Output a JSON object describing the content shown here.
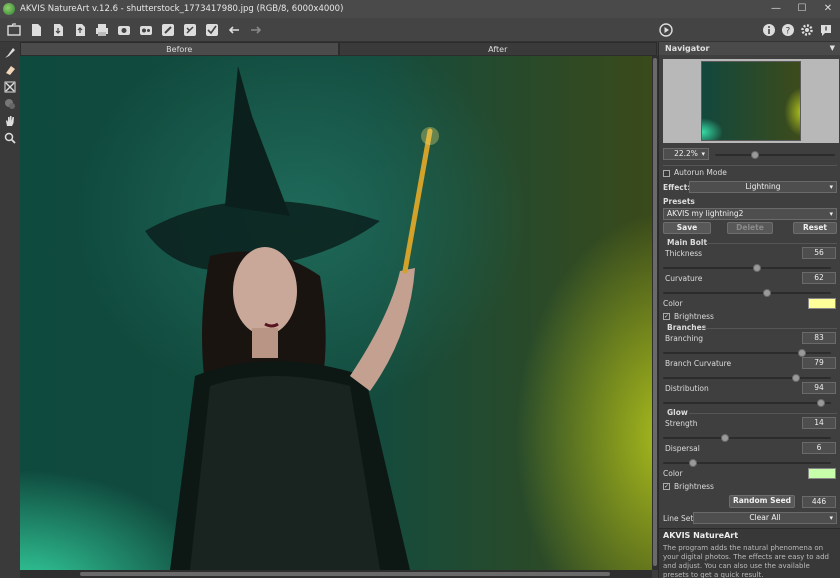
{
  "window": {
    "title": "AKVIS NatureArt v.12.6 - shutterstock_1773417980.jpg (RGB/8, 6000x4000)"
  },
  "toolbar": {
    "icons": [
      "open-file-icon",
      "new-file-icon",
      "save-icon",
      "export-icon",
      "print-icon",
      "batch-icon",
      "plugin-icon",
      "brush-icon",
      "eraser-icon",
      "share-icon",
      "undo-icon",
      "redo-icon",
      "run-icon",
      "info-icon",
      "help-icon",
      "settings-icon",
      "news-icon"
    ]
  },
  "tabs": {
    "before": "Before",
    "after": "After"
  },
  "navigator": {
    "title": "Navigator",
    "zoom": "22.2%"
  },
  "settings": {
    "autorun_label": "Autorun Mode",
    "effect_label": "Effect:",
    "effect_value": "Lightning",
    "presets_label": "Presets",
    "preset_value": "AKVIS my lightning2",
    "save": "Save",
    "delete": "Delete",
    "reset": "Reset",
    "main_bolt": {
      "title": "Main Bolt",
      "thickness_label": "Thickness",
      "thickness": 56,
      "curvature_label": "Curvature",
      "curvature": 62,
      "color_label": "Color",
      "color": "#ffff99",
      "brightness_label": "Brightness"
    },
    "branches": {
      "title": "Branches",
      "branching_label": "Branching",
      "branching": 83,
      "branch_curvature_label": "Branch Curvature",
      "branch_curvature": 79,
      "distribution_label": "Distribution",
      "distribution": 94
    },
    "glow": {
      "title": "Glow",
      "strength_label": "Strength",
      "strength": 14,
      "dispersal_label": "Dispersal",
      "dispersal": 6,
      "color_label": "Color",
      "color": "#c8ffaa",
      "brightness_label": "Brightness"
    },
    "random_seed_label": "Random Seed",
    "random_seed": 446,
    "line_set_label": "Line Set",
    "line_set_value": "Clear All"
  },
  "info": {
    "title": "AKVIS NatureArt",
    "text": "The program adds the natural phenomena on your digital photos. The effects are easy to add and adjust. You can also use the available presets to get a quick result."
  }
}
